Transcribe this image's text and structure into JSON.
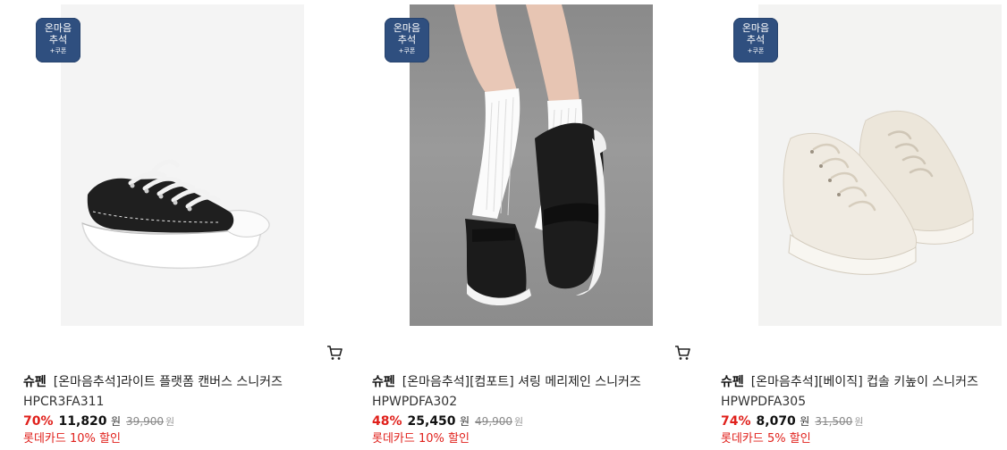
{
  "products": [
    {
      "badge": {
        "line1": "온마음",
        "line2": "추석",
        "line3": "+쿠폰"
      },
      "brand": "슈펜",
      "name": "[온마음추석]라이트 플랫폼 캔버스 스니커즈",
      "code": "HPCR3FA311",
      "discount": "70%",
      "price": "11,820",
      "currency": "원",
      "original_price": "39,900",
      "original_currency": "원",
      "promo": "롯데카드 10% 할인"
    },
    {
      "badge": {
        "line1": "온마음",
        "line2": "추석",
        "line3": "+쿠폰"
      },
      "brand": "슈펜",
      "name": "[온마음추석][컴포트] 셔링 메리제인 스니커즈",
      "code": "HPWPDFA302",
      "discount": "48%",
      "price": "25,450",
      "currency": "원",
      "original_price": "49,900",
      "original_currency": "원",
      "promo": "롯데카드 10% 할인"
    },
    {
      "badge": {
        "line1": "온마음",
        "line2": "추석",
        "line3": "+쿠폰"
      },
      "brand": "슈펜",
      "name": "[온마음추석][베이직] 컵솔 키높이 스니커즈",
      "code": "HPWPDFA305",
      "discount": "74%",
      "price": "8,070",
      "currency": "원",
      "original_price": "31,500",
      "original_currency": "원",
      "promo": "롯데카드 5% 할인"
    }
  ],
  "colors": {
    "badge": "#2f4f7f",
    "discount": "#e0201b"
  }
}
